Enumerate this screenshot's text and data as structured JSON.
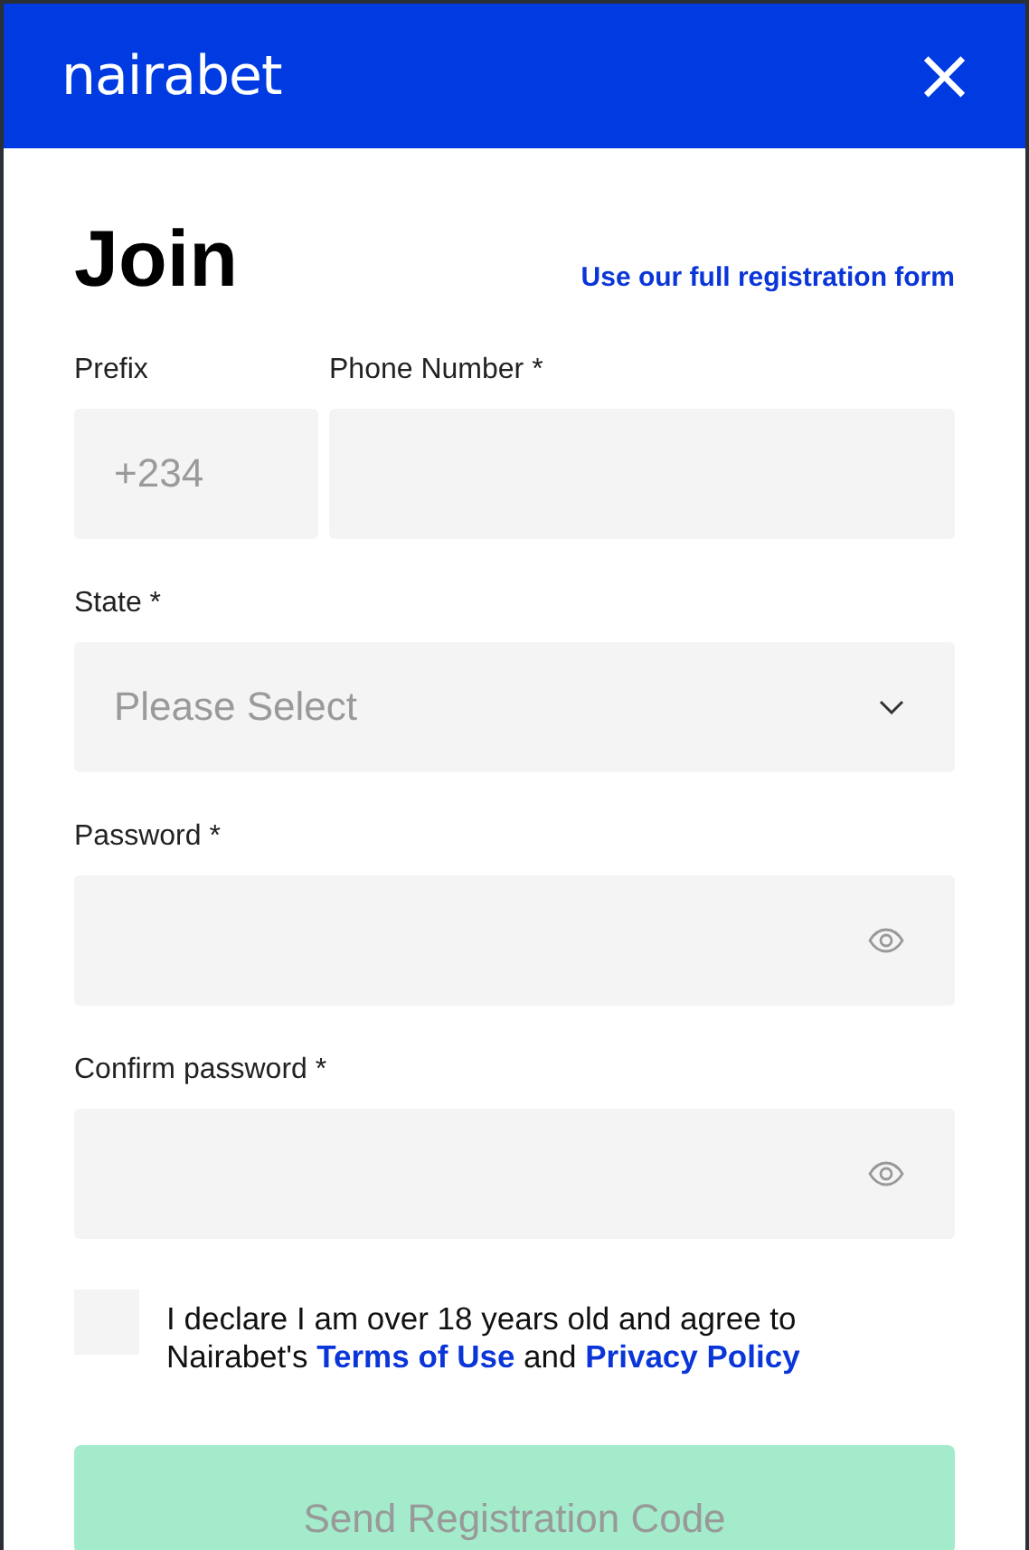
{
  "header": {
    "brand": "nairabet",
    "close": "×"
  },
  "title": "Join",
  "full_form_link": "Use our full registration form",
  "fields": [
    {
      "kind": "prefix",
      "label": "Prefix",
      "value": "+234"
    },
    {
      "kind": "text",
      "label": "Phone Number *"
    },
    {
      "kind": "select",
      "label": "State *",
      "placeholder": "Please Select"
    },
    {
      "kind": "password",
      "label": "Password *"
    },
    {
      "kind": "password",
      "label": "Confirm password *"
    }
  ],
  "consent": {
    "checked": false,
    "parts": [
      {
        "kind": "text",
        "text": "I declare I am over 18 years old and agree to Nairabet's "
      },
      {
        "kind": "link",
        "text": "Terms of Use"
      },
      {
        "kind": "text",
        "text": " and "
      },
      {
        "kind": "link",
        "text": "Privacy Policy"
      }
    ]
  },
  "submit": {
    "label": "Send Registration Code",
    "disabled": true
  }
}
